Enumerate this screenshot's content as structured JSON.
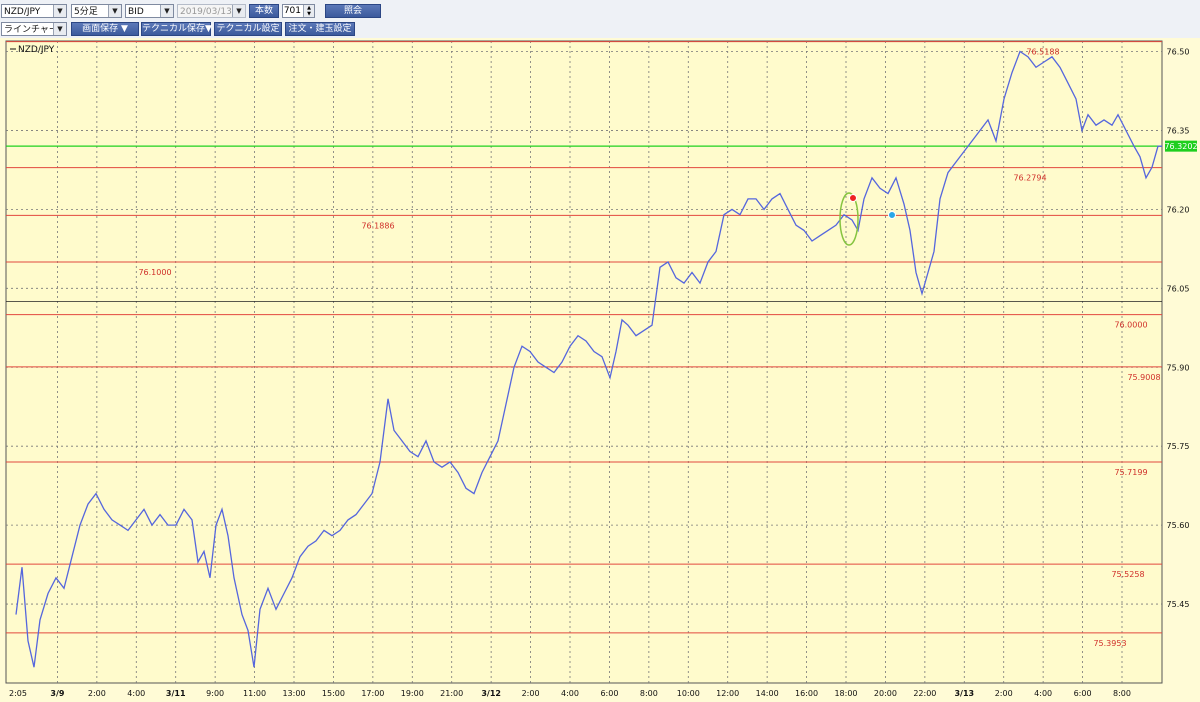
{
  "toolbar": {
    "pair": "NZD/JPY",
    "timeframe": "5分足",
    "price_type": "BID",
    "date": "2019/03/13",
    "count_button": "本数",
    "count_value": "701",
    "query_button": "照会",
    "chart_style": "ラインチャート",
    "save_image": "画面保存 ▼",
    "save_technical": "テクニカル保存▼",
    "technical_settings": "テクニカル設定",
    "order_settings": "注文・建玉設定"
  },
  "chart_data": {
    "type": "line",
    "title": "NZD/JPY",
    "ylim": [
      75.3,
      76.52
    ],
    "y_ticks": [
      76.5,
      76.35,
      76.2,
      76.05,
      75.9,
      75.75,
      75.6,
      75.45
    ],
    "y_tick_labels": [
      "76.50",
      "76.35",
      "76.20",
      "76.05",
      "75.90",
      "75.75",
      "75.60",
      "75.45"
    ],
    "x_tick_labels": [
      "2:05",
      "3/9",
      "2:00",
      "4:00",
      "3/11",
      "9:00",
      "11:00",
      "13:00",
      "15:00",
      "17:00",
      "19:00",
      "21:00",
      "3/12",
      "2:00",
      "4:00",
      "6:00",
      "8:00",
      "10:00",
      "12:00",
      "14:00",
      "16:00",
      "18:00",
      "20:00",
      "22:00",
      "3/13",
      "2:00",
      "4:00",
      "6:00",
      "8:00"
    ],
    "x_tick_bold": [
      "3/9",
      "3/11",
      "3/12",
      "3/13"
    ],
    "current_price": 76.3202,
    "current_price_label": "76.3202",
    "reference_price": 76.025,
    "levels": [
      {
        "value": 76.5188,
        "label": "76.5188"
      },
      {
        "value": 76.2794,
        "label": "76.2794"
      },
      {
        "value": 76.1886,
        "label": "76.1886"
      },
      {
        "value": 76.1,
        "label": "76.1000"
      },
      {
        "value": 76.0,
        "label": "76.0000"
      },
      {
        "value": 75.9008,
        "label": "75.9008"
      },
      {
        "value": 75.7199,
        "label": "75.7199"
      },
      {
        "value": 75.5258,
        "label": "75.5258"
      },
      {
        "value": 75.3953,
        "label": "75.3953"
      }
    ],
    "series": [
      {
        "points": [
          [
            0,
            75.43
          ],
          [
            6,
            75.52
          ],
          [
            12,
            75.38
          ],
          [
            18,
            75.33
          ],
          [
            24,
            75.42
          ],
          [
            32,
            75.47
          ],
          [
            40,
            75.5
          ],
          [
            48,
            75.48
          ],
          [
            56,
            75.54
          ],
          [
            64,
            75.6
          ],
          [
            72,
            75.64
          ],
          [
            80,
            75.66
          ],
          [
            88,
            75.63
          ],
          [
            96,
            75.61
          ],
          [
            104,
            75.6
          ],
          [
            112,
            75.59
          ],
          [
            120,
            75.61
          ],
          [
            128,
            75.63
          ],
          [
            136,
            75.6
          ],
          [
            144,
            75.62
          ],
          [
            152,
            75.6
          ],
          [
            160,
            75.6
          ],
          [
            168,
            75.63
          ],
          [
            176,
            75.61
          ],
          [
            182,
            75.53
          ],
          [
            188,
            75.55
          ],
          [
            194,
            75.5
          ],
          [
            200,
            75.6
          ],
          [
            206,
            75.63
          ],
          [
            212,
            75.58
          ],
          [
            218,
            75.5
          ],
          [
            226,
            75.43
          ],
          [
            232,
            75.4
          ],
          [
            238,
            75.33
          ],
          [
            244,
            75.44
          ],
          [
            252,
            75.48
          ],
          [
            260,
            75.44
          ],
          [
            268,
            75.47
          ],
          [
            276,
            75.5
          ],
          [
            284,
            75.54
          ],
          [
            292,
            75.56
          ],
          [
            300,
            75.57
          ],
          [
            308,
            75.59
          ],
          [
            316,
            75.58
          ],
          [
            324,
            75.59
          ],
          [
            332,
            75.61
          ],
          [
            340,
            75.62
          ],
          [
            348,
            75.64
          ],
          [
            356,
            75.66
          ],
          [
            364,
            75.72
          ],
          [
            372,
            75.84
          ],
          [
            378,
            75.78
          ],
          [
            386,
            75.76
          ],
          [
            394,
            75.74
          ],
          [
            402,
            75.73
          ],
          [
            410,
            75.76
          ],
          [
            418,
            75.72
          ],
          [
            426,
            75.71
          ],
          [
            434,
            75.72
          ],
          [
            442,
            75.7
          ],
          [
            450,
            75.67
          ],
          [
            458,
            75.66
          ],
          [
            466,
            75.7
          ],
          [
            474,
            75.73
          ],
          [
            482,
            75.76
          ],
          [
            490,
            75.83
          ],
          [
            498,
            75.9
          ],
          [
            506,
            75.94
          ],
          [
            514,
            75.93
          ],
          [
            522,
            75.91
          ],
          [
            530,
            75.9
          ],
          [
            538,
            75.89
          ],
          [
            546,
            75.91
          ],
          [
            554,
            75.94
          ],
          [
            562,
            75.96
          ],
          [
            570,
            75.95
          ],
          [
            578,
            75.93
          ],
          [
            586,
            75.92
          ],
          [
            594,
            75.88
          ],
          [
            600,
            75.93
          ],
          [
            606,
            75.99
          ],
          [
            612,
            75.98
          ],
          [
            620,
            75.96
          ],
          [
            628,
            75.97
          ],
          [
            636,
            75.98
          ],
          [
            644,
            76.09
          ],
          [
            652,
            76.1
          ],
          [
            660,
            76.07
          ],
          [
            668,
            76.06
          ],
          [
            676,
            76.08
          ],
          [
            684,
            76.06
          ],
          [
            692,
            76.1
          ],
          [
            700,
            76.12
          ],
          [
            708,
            76.19
          ],
          [
            716,
            76.2
          ],
          [
            724,
            76.19
          ],
          [
            732,
            76.22
          ],
          [
            740,
            76.22
          ],
          [
            748,
            76.2
          ],
          [
            756,
            76.22
          ],
          [
            764,
            76.23
          ],
          [
            772,
            76.2
          ],
          [
            780,
            76.17
          ],
          [
            788,
            76.16
          ],
          [
            796,
            76.14
          ],
          [
            804,
            76.15
          ],
          [
            812,
            76.16
          ],
          [
            820,
            76.17
          ],
          [
            828,
            76.19
          ],
          [
            836,
            76.18
          ],
          [
            842,
            76.16
          ],
          [
            848,
            76.22
          ],
          [
            856,
            76.26
          ],
          [
            864,
            76.24
          ],
          [
            872,
            76.23
          ],
          [
            880,
            76.26
          ],
          [
            888,
            76.21
          ],
          [
            894,
            76.16
          ],
          [
            900,
            76.08
          ],
          [
            906,
            76.04
          ],
          [
            912,
            76.08
          ],
          [
            918,
            76.12
          ],
          [
            924,
            76.22
          ],
          [
            932,
            76.27
          ],
          [
            940,
            76.29
          ],
          [
            948,
            76.31
          ],
          [
            956,
            76.33
          ],
          [
            964,
            76.35
          ],
          [
            972,
            76.37
          ],
          [
            980,
            76.33
          ],
          [
            988,
            76.41
          ],
          [
            996,
            76.46
          ],
          [
            1004,
            76.5
          ],
          [
            1012,
            76.49
          ],
          [
            1020,
            76.47
          ],
          [
            1028,
            76.48
          ],
          [
            1036,
            76.49
          ],
          [
            1044,
            76.47
          ],
          [
            1052,
            76.44
          ],
          [
            1060,
            76.41
          ],
          [
            1066,
            76.35
          ],
          [
            1072,
            76.38
          ],
          [
            1080,
            76.36
          ],
          [
            1088,
            76.37
          ],
          [
            1096,
            76.36
          ],
          [
            1102,
            76.38
          ],
          [
            1110,
            76.35
          ],
          [
            1118,
            76.32
          ],
          [
            1124,
            76.3
          ],
          [
            1130,
            76.26
          ],
          [
            1136,
            76.28
          ],
          [
            1142,
            76.32
          ],
          [
            1146,
            76.32
          ]
        ]
      }
    ]
  }
}
